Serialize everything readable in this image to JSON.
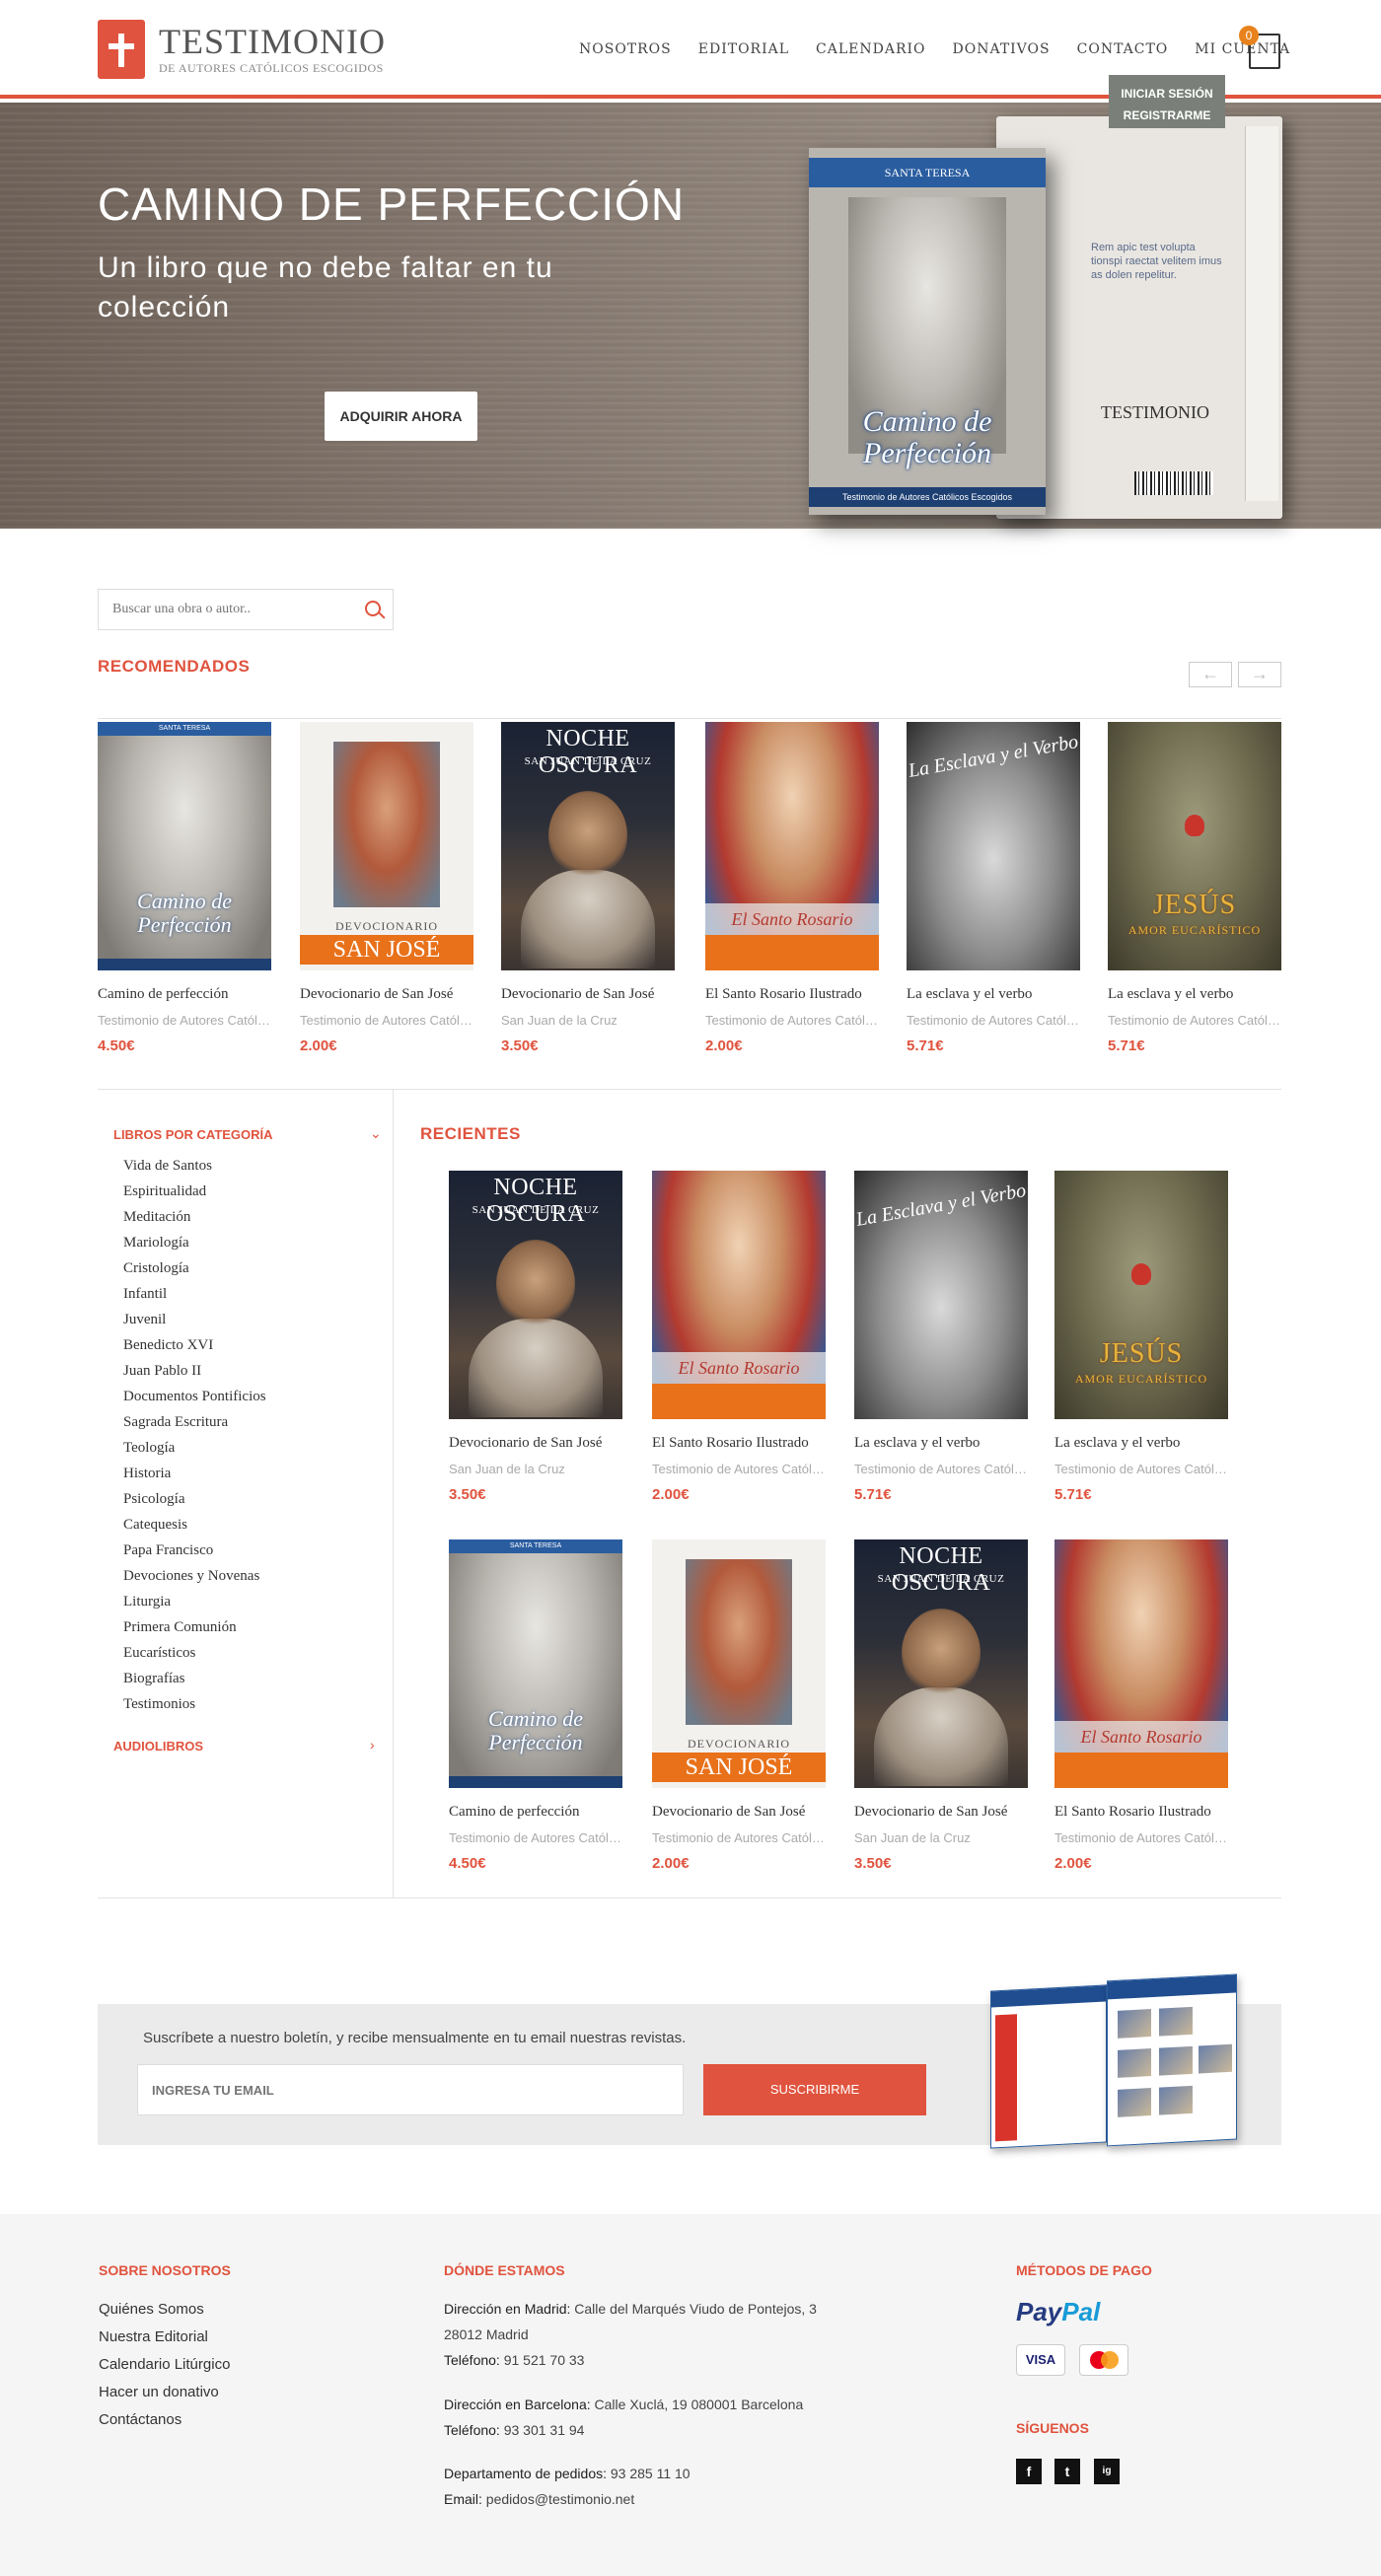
{
  "header": {
    "logo_name": "TESTIMONIO",
    "logo_sub": "DE AUTORES CATÓLICOS ESCOGIDOS",
    "nav": [
      "NOSOTROS",
      "EDITORIAL",
      "CALENDARIO",
      "DONATIVOS",
      "CONTACTO",
      "MI CUENTA"
    ],
    "cart_count": "0",
    "account_menu": [
      "INICIAR SESIÓN",
      "REGISTRARME"
    ]
  },
  "hero": {
    "title": "CAMINO DE PERFECCIÓN",
    "subtitle": "Un libro que no debe faltar en tu colección",
    "button": "ADQUIRIR AHORA",
    "book_band": "SANTA TERESA",
    "book_title": "Camino de Perfección",
    "book_footer": "Testimonio de Autores Católicos Escogidos",
    "book_back_logo": "TESTIMONIO",
    "book_back_text": "Rem apic test volupta tionspi raectat velitem imus as dolen repelitur."
  },
  "search": {
    "placeholder": "Buscar una obra o autor.."
  },
  "recommended": {
    "title": "RECOMENDADOS",
    "items": [
      {
        "name": "Camino de perfección",
        "author": "Testimonio de Autores Católicos Escogidos",
        "price": "4.50€",
        "cover": "camino"
      },
      {
        "name": "Devocionario de San José",
        "author": "Testimonio de Autores Católicos Escogidos",
        "price": "2.00€",
        "cover": "jose"
      },
      {
        "name": "Devocionario de San José",
        "author": "San Juan de la Cruz",
        "price": "3.50€",
        "cover": "noche"
      },
      {
        "name": "El Santo Rosario Ilustrado",
        "author": "Testimonio de Autores Católicos Escogidos",
        "price": "2.00€",
        "cover": "rosario"
      },
      {
        "name": "La esclava y el verbo",
        "author": "Testimonio de Autores Católicos Escogidos",
        "price": "5.71€",
        "cover": "esclava"
      },
      {
        "name": "La esclava y el verbo",
        "author": "Testimonio de Autores Católicos Escogidos",
        "price": "5.71€",
        "cover": "jesus"
      }
    ]
  },
  "covers": {
    "camino_band": "SANTA TERESA",
    "camino_title": "Camino de Perfección",
    "jose_label": "DEVOCIONARIO",
    "jose_title": "SAN JOSÉ",
    "noche_title": "NOCHE OSCURA",
    "noche_sub": "SAN JUAN DE LA CRUZ",
    "rosario_title": "El Santo Rosario",
    "esclava_title": "La Esclava y el Verbo",
    "jesus_title": "JESÚS",
    "jesus_sub": "AMOR EUCARÍSTICO"
  },
  "sidebar": {
    "heading": "LIBROS POR CATEGORÍA",
    "categories": [
      "Vida de Santos",
      "Espiritualidad",
      "Meditación",
      "Mariología",
      "Cristología",
      "Infantil",
      "Juvenil",
      "Benedicto XVI",
      "Juan Pablo II",
      "Documentos Pontificios",
      "Sagrada Escritura",
      "Teología",
      "Historia",
      "Psicología",
      "Catequesis",
      "Papa Francisco",
      "Devociones y Novenas",
      "Liturgia",
      "Primera Comunión",
      "Eucarísticos",
      "Biografías",
      "Testimonios"
    ],
    "audio_heading": "AUDIOLIBROS"
  },
  "recent": {
    "title": "RECIENTES",
    "items": [
      {
        "name": "Devocionario de San José",
        "author": "San Juan de la Cruz",
        "price": "3.50€",
        "cover": "noche"
      },
      {
        "name": "El Santo Rosario Ilustrado",
        "author": "Testimonio de Autores Católicos Escogidos",
        "price": "2.00€",
        "cover": "rosario"
      },
      {
        "name": "La esclava y el verbo",
        "author": "Testimonio de Autores Católicos Escogidos",
        "price": "5.71€",
        "cover": "esclava"
      },
      {
        "name": "La esclava y el verbo",
        "author": "Testimonio de Autores Católicos Escogidos",
        "price": "5.71€",
        "cover": "jesus"
      },
      {
        "name": "Camino de perfección",
        "author": "Testimonio de Autores Católicos Escogidos",
        "price": "4.50€",
        "cover": "camino"
      },
      {
        "name": "Devocionario de San José",
        "author": "Testimonio de Autores Católicos Escogidos",
        "price": "2.00€",
        "cover": "jose"
      },
      {
        "name": "Devocionario de San José",
        "author": "San Juan de la Cruz",
        "price": "3.50€",
        "cover": "noche"
      },
      {
        "name": "El Santo Rosario Ilustrado",
        "author": "Testimonio de Autores Católicos Escogidos",
        "price": "2.00€",
        "cover": "rosario"
      }
    ]
  },
  "newsletter": {
    "text": "Suscríbete a nuestro boletín, y recibe mensualmente en tu email nuestras revistas.",
    "placeholder": "INGRESA TU EMAIL",
    "button": "SUSCRIBIRME"
  },
  "footer": {
    "about_title": "SOBRE NOSOTROS",
    "about_links": [
      "Quiénes Somos",
      "Nuestra Editorial",
      "Calendario Litúrgico",
      "Hacer un donativo",
      "Contáctanos"
    ],
    "where_title": "DÓNDE ESTAMOS",
    "madrid_label": "Dirección en Madrid:",
    "madrid_address": "Calle del Marqués Viudo de Pontejos, 3 28012 Madrid",
    "madrid_phone_label": "Teléfono:",
    "madrid_phone": "91 521 70 33",
    "bcn_label": "Dirección en Barcelona:",
    "bcn_address": "Calle Xuclá, 19 080001 Barcelona",
    "bcn_phone_label": "Teléfono:",
    "bcn_phone": "93 301 31 94",
    "orders_label": "Departamento de pedidos:",
    "orders_phone": "93 285 11 10",
    "email_label": "Email:",
    "email": "pedidos@testimonio.net",
    "payment_title": "MÉTODOS DE PAGO",
    "paypal": "PayPal",
    "visa": "VISA",
    "mastercard": "MasterCard",
    "follow_title": "SÍGUENOS",
    "social": [
      "f",
      "t",
      "ig"
    ]
  },
  "colors": {
    "accent": "#e0533e",
    "cart_badge": "#e8821c",
    "footer_bg": "#f5f5f5",
    "newsletter_bg": "#ebebeb"
  }
}
